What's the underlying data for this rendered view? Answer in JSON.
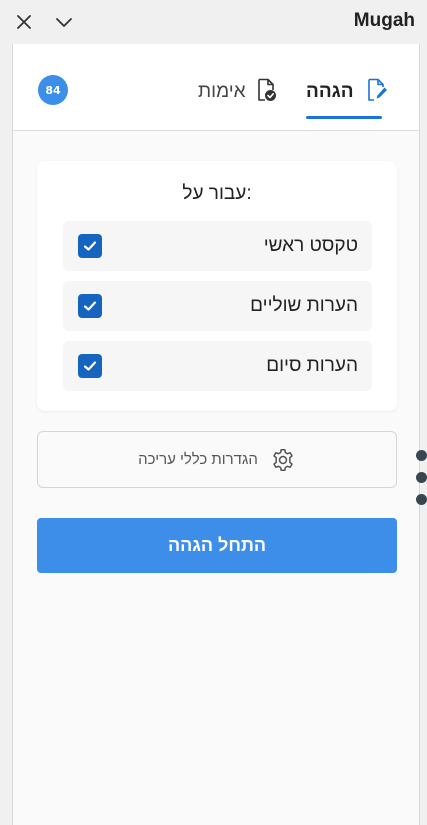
{
  "window": {
    "title": "Mugah",
    "close_icon": "close-icon",
    "collapse_icon": "chevron-down-icon"
  },
  "tabs": {
    "count_badge": "84",
    "items": [
      {
        "label": "הגהה",
        "icon": "document-edit-icon",
        "active": true
      },
      {
        "label": "אימות",
        "icon": "document-check-icon",
        "active": false
      }
    ]
  },
  "scope": {
    "title": "עבור על:",
    "options": [
      {
        "label": "טקסט ראשי",
        "checked": true
      },
      {
        "label": "הערות שוליים",
        "checked": true
      },
      {
        "label": "הערות סיום",
        "checked": true
      }
    ]
  },
  "edit_settings": {
    "label": "הגדרות כללי עריכה",
    "icon": "gear-icon"
  },
  "start_button": {
    "label": "התחל הגהה"
  },
  "colors": {
    "accent": "#3d8ee8",
    "checkbox": "#1565c0",
    "tab_underline": "#1a73d9"
  }
}
